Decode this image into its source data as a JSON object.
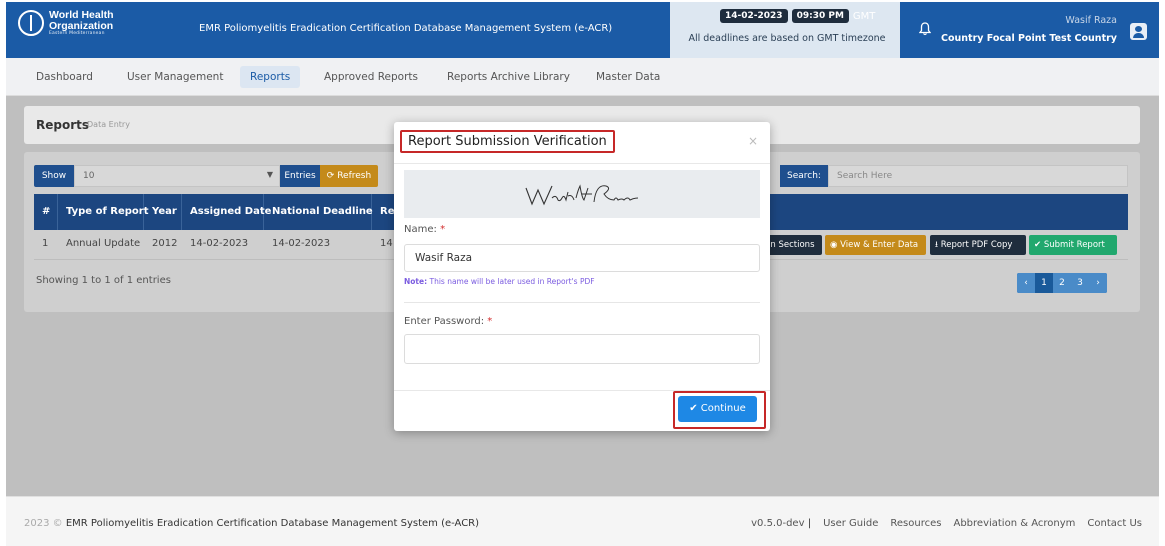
{
  "header": {
    "logo": {
      "line1": "World Health",
      "line2": "Organization",
      "line3": "Eastern Mediterranean"
    },
    "app_title": "EMR Poliomyelitis Eradication Certification Database Management System (e-ACR)",
    "date": "14-02-2023",
    "time": "09:30 PM",
    "timezone": "GMT",
    "deadline_note": "All deadlines are based on GMT timezone",
    "user_name": "Wasif Raza",
    "user_role": "Country Focal Point Test Country"
  },
  "nav": {
    "items": [
      {
        "label": "Dashboard"
      },
      {
        "label": "User Management"
      },
      {
        "label": "Reports"
      },
      {
        "label": "Approved Reports"
      },
      {
        "label": "Reports Archive Library"
      },
      {
        "label": "Master Data"
      }
    ],
    "active": "Reports"
  },
  "page": {
    "title": "Reports",
    "subtitle": "Data Entry",
    "show_label": "Show",
    "show_value": "10",
    "entries_label": "Entries",
    "refresh_label": "Refresh",
    "search_label": "Search:",
    "search_placeholder": "Search Here",
    "table": {
      "headers": [
        "#",
        "Type of Report",
        "Year",
        "Assigned Date",
        "National Deadline",
        "Re"
      ],
      "rows": [
        {
          "num": "1",
          "type": "Annual Update",
          "year": "2012",
          "assigned": "14-02-2023",
          "deadline": "14-02-2023",
          "extra": "14"
        }
      ]
    },
    "actions": {
      "assign": "gn Sections",
      "view": "View & Enter Data",
      "pdf": "Report PDF Copy",
      "submit": "Submit Report"
    },
    "showing": "Showing 1 to 1 of 1 entries",
    "pager": {
      "pages": [
        "1",
        "2",
        "3"
      ],
      "prev": "‹",
      "next": "›"
    }
  },
  "footer": {
    "year": "2023 ©",
    "copyright": "EMR Poliomyelitis Eradication Certification Database Management System (e-ACR)",
    "version": "v0.5.0-dev",
    "sep": "|",
    "links": [
      "User Guide",
      "Resources",
      "Abbreviation & Acronym",
      "Contact Us"
    ]
  },
  "modal": {
    "title": "Report Submission Verification",
    "close": "×",
    "signature_text": "Wasif Raza",
    "name_label": "Name:",
    "required_mark": "*",
    "name_value": "Wasif Raza",
    "note_label": "Note:",
    "note_text": "This name will be later used in Report's PDF",
    "password_label": "Enter Password:",
    "password_value": "",
    "continue_label": "Continue"
  },
  "colors": {
    "brand": "#1b5ba6",
    "highlight": "#c62828",
    "continue": "#1e88e5",
    "submit": "#21a86e",
    "warning": "#c48a1a"
  }
}
